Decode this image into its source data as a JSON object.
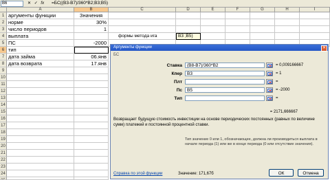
{
  "formula_bar": {
    "name_box": "B6",
    "fx_icons": [
      "✕",
      "✓",
      "fx"
    ],
    "formula": "=БС((B3-B7)/360*B2;B3;B5)"
  },
  "columns": [
    "A",
    "B",
    "C",
    "D",
    "E",
    "F",
    "G",
    "H",
    "I"
  ],
  "rows": [
    "1",
    "2",
    "3",
    "4",
    "5",
    "6",
    "7",
    "8",
    "9",
    "10",
    "11",
    "12",
    "13",
    "14",
    "15",
    "16",
    "17",
    "18",
    "19",
    "20",
    "21",
    "22",
    "23",
    "24",
    "25"
  ],
  "cells": {
    "a1": "аргументы функции",
    "b1": "Значения",
    "a2": "норме",
    "b2": "30%",
    "a3": "число периодов",
    "b3": "1",
    "a4": "выплата",
    "a5": "ПС",
    "b5": "-2000",
    "a6": "тип",
    "a7": "дата займа",
    "b7": "06.янв",
    "a8": "дата возврата",
    "b8": "17.янв",
    "c4": "формы метода ига",
    "d4": "B3 ;B5)"
  },
  "dialog": {
    "title": "Аргументы функции",
    "function_name": "БС",
    "args": [
      {
        "label": "Ставка",
        "value": "(B8-B7)/360*B2",
        "result": "= 0,009166667"
      },
      {
        "label": "Кпер",
        "value": "B3",
        "result": "= 1"
      },
      {
        "label": "Плт",
        "value": "",
        "result": "="
      },
      {
        "label": "Пс",
        "value": "B5",
        "result": "= -2000"
      },
      {
        "label": "Тип",
        "value": "",
        "result": "="
      }
    ],
    "result": "= 2171,666667",
    "description": "Возвращает будущую стоимость инвестиции на основе периодических постоянных (равных по величине сумм) платежей и постоянной процентной ставки.",
    "arg_description": "Тип   значение 0 или 1, обозначающее, должна ли производиться выплата в начале периода (1) или же в конце периода (0 или отсутствие значения).",
    "help_link": "Справка по этой функции",
    "value_text": "Значение: 171,67б",
    "ok_label": "ОК",
    "cancel_label": "Отмена"
  },
  "colors": {
    "accent": "#2456c6",
    "header_sel": "#f7c98f",
    "dialog_bg": "#ece9d8"
  }
}
